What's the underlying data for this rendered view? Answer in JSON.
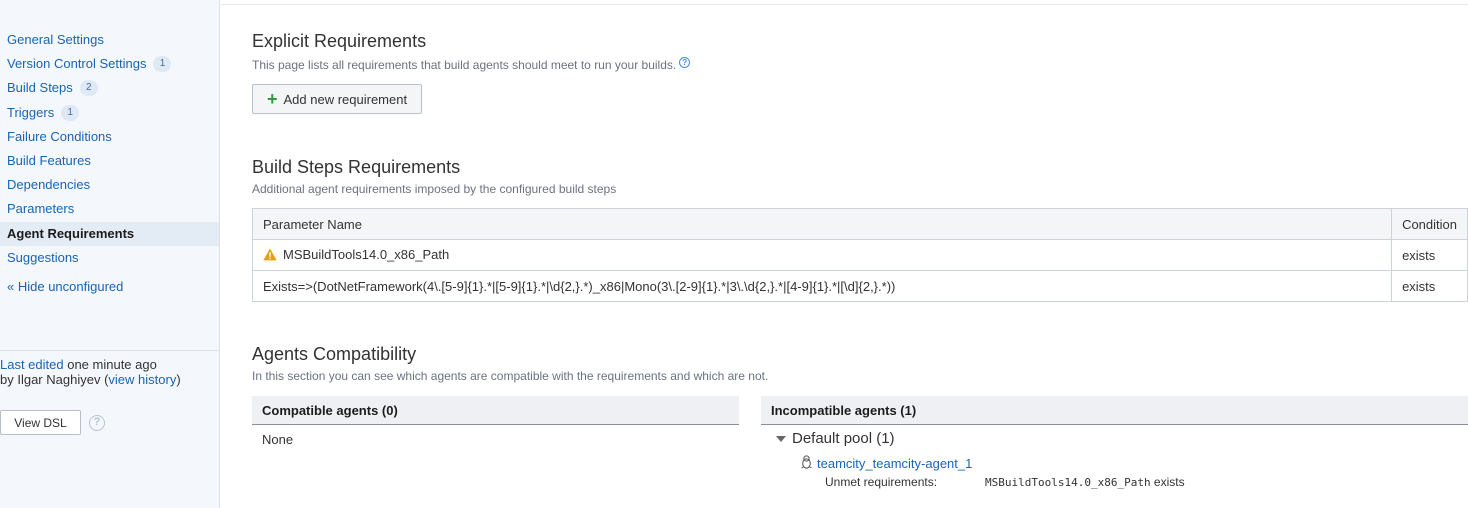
{
  "sidebar": {
    "items": [
      {
        "label": "General Settings",
        "badge": ""
      },
      {
        "label": "Version Control Settings",
        "badge": "1"
      },
      {
        "label": "Build Steps",
        "badge": "2"
      },
      {
        "label": "Triggers",
        "badge": "1"
      },
      {
        "label": "Failure Conditions",
        "badge": ""
      },
      {
        "label": "Build Features",
        "badge": ""
      },
      {
        "label": "Dependencies",
        "badge": ""
      },
      {
        "label": "Parameters",
        "badge": ""
      },
      {
        "label": "Agent Requirements",
        "badge": "",
        "active": true
      },
      {
        "label": "Suggestions",
        "badge": ""
      }
    ],
    "hide_unconfigured": "« Hide unconfigured",
    "last_edited_link": "Last edited",
    "last_edited_time": " one minute ago",
    "edited_by": "by Ilgar Naghiyev",
    "view_history_open": " (",
    "view_history": "view history",
    "view_history_close": ")",
    "view_dsl": "View DSL",
    "help_glyph": "?"
  },
  "explicit": {
    "title": "Explicit Requirements",
    "description": "This page lists all requirements that build agents should meet to run your builds.",
    "help_glyph": "?",
    "add_icon": "plus-icon",
    "add_button": "Add new requirement"
  },
  "build_steps": {
    "title": "Build Steps Requirements",
    "description": "Additional agent requirements imposed by the configured build steps",
    "table": {
      "col_param": "Parameter Name",
      "col_condition": "Condition",
      "rows": [
        {
          "param": "MSBuildTools14.0_x86_Path",
          "condition": "exists",
          "warning": true
        },
        {
          "param": "Exists=>(DotNetFramework(4\\.[5-9]{1}.*|[5-9]{1}.*|\\d{2,}.*)_x86|Mono(3\\.[2-9]{1}.*|3\\.\\d{2,}.*|[4-9]{1}.*|[\\d]{2,}.*))",
          "condition": "exists",
          "warning": false
        }
      ]
    }
  },
  "agents": {
    "title": "Agents Compatibility",
    "description": "In this section you can see which agents are compatible with the requirements and which are not.",
    "compatible_header": "Compatible agents (0)",
    "compatible_none": "None",
    "incompatible_header": "Incompatible agents (1)",
    "pool": "Default pool (1)",
    "agent_icon": "linux-penguin-icon",
    "agent_name": "teamcity_teamcity-agent_1",
    "unmet_label": "Unmet requirements:",
    "unmet_param": "MSBuildTools14.0_x86_Path",
    "unmet_condition": " exists"
  },
  "colors": {
    "link": "#1a64b2",
    "warning": "#e5a100",
    "sidebar_bg": "#f4f7fb",
    "add_icon": "#2d9c3d"
  }
}
